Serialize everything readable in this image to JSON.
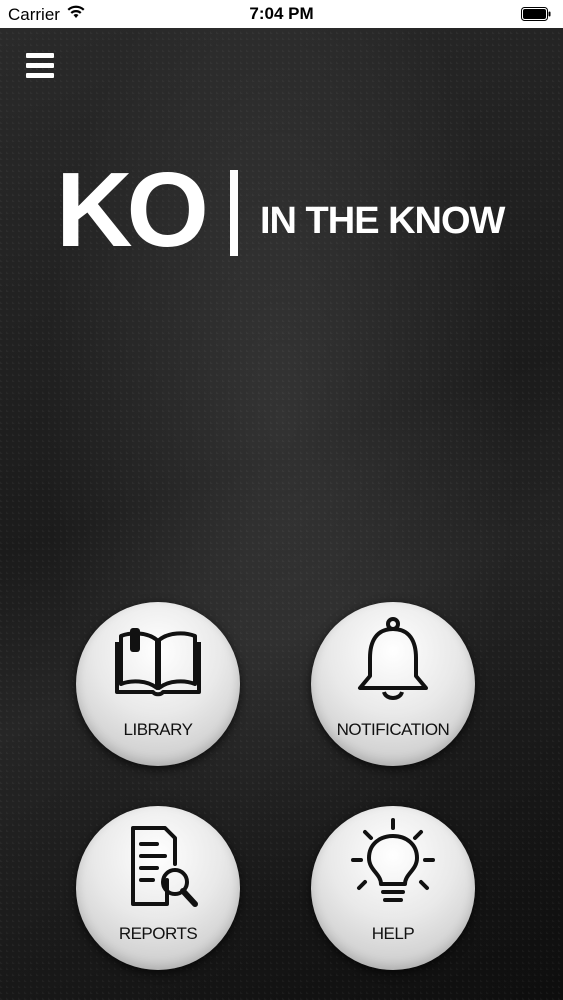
{
  "status_bar": {
    "carrier": "Carrier",
    "time": "7:04 PM"
  },
  "header": {
    "menu_icon": "hamburger-menu-icon"
  },
  "logo": {
    "primary": "KO",
    "tagline": "IN THE KNOW"
  },
  "tiles": [
    {
      "label": "LIBRARY",
      "icon": "open-book-icon"
    },
    {
      "label": "NOTIFICATION",
      "icon": "bell-icon"
    },
    {
      "label": "REPORTS",
      "icon": "report-search-icon"
    },
    {
      "label": "HELP",
      "icon": "lightbulb-icon"
    }
  ],
  "colors": {
    "background": "#1e1e1e",
    "tile": "#e6e6e6",
    "text_light": "#ffffff",
    "text_dark": "#111111"
  }
}
